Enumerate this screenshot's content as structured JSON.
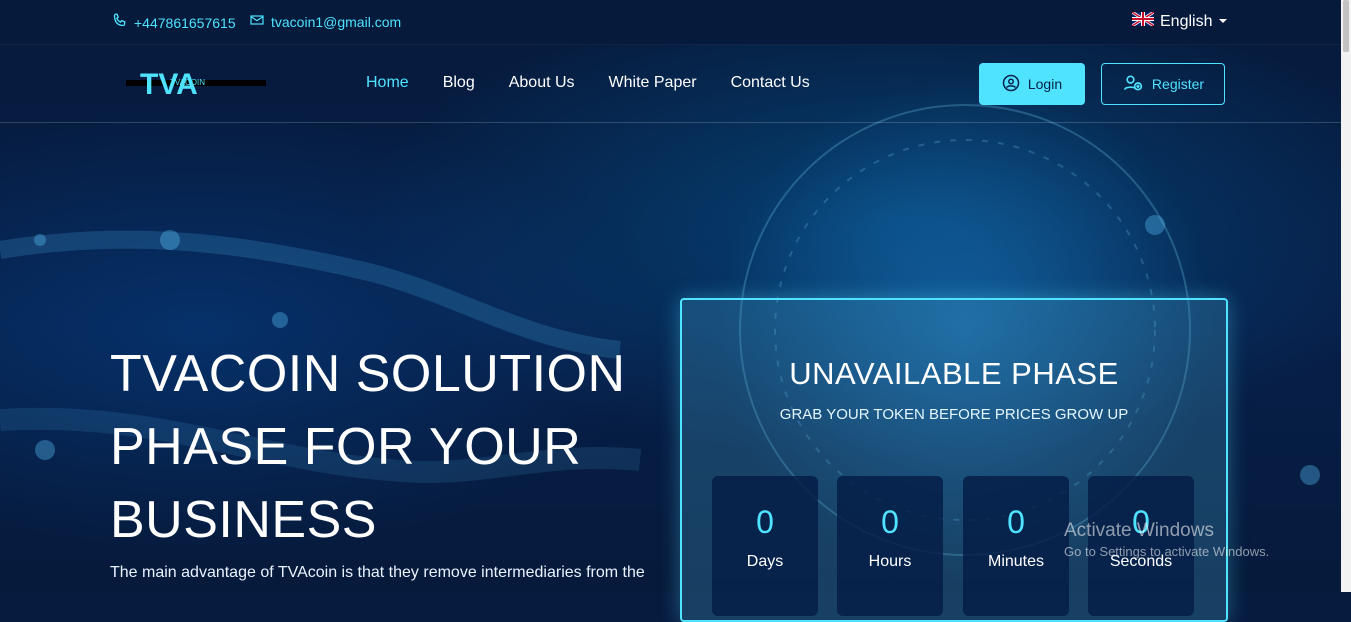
{
  "topbar": {
    "phone": "+447861657615",
    "email": "tvacoin1@gmail.com",
    "language": "English"
  },
  "nav": {
    "logo_text": "TVA",
    "logo_subtext": "TVACOIN",
    "items": [
      {
        "label": "Home",
        "active": true
      },
      {
        "label": "Blog",
        "active": false
      },
      {
        "label": "About Us",
        "active": false
      },
      {
        "label": "White Paper",
        "active": false
      },
      {
        "label": "Contact Us",
        "active": false
      }
    ],
    "login_label": "Login",
    "register_label": "Register"
  },
  "hero": {
    "title_lines": [
      "TVACOIN SOLUTION",
      "PHASE FOR YOUR",
      "BUSINESS"
    ],
    "description": "The main advantage of TVAcoin is that they remove intermediaries from the"
  },
  "phase": {
    "title": "UNAVAILABLE PHASE",
    "subtitle": "GRAB YOUR TOKEN BEFORE PRICES GROW UP",
    "counters": [
      {
        "value": "0",
        "label": "Days"
      },
      {
        "value": "0",
        "label": "Hours"
      },
      {
        "value": "0",
        "label": "Minutes"
      },
      {
        "value": "0",
        "label": "Seconds"
      }
    ]
  },
  "watermark": {
    "line1": "Activate Windows",
    "line2": "Go to Settings to activate Windows."
  },
  "colors": {
    "accent": "#4fe3ff",
    "background": "#071b3f"
  },
  "icons": {
    "phone": "phone-icon",
    "email": "mail-icon",
    "flag": "uk-flag-icon",
    "caret": "caret-down-icon",
    "login": "user-icon",
    "register": "user-plus-icon"
  }
}
